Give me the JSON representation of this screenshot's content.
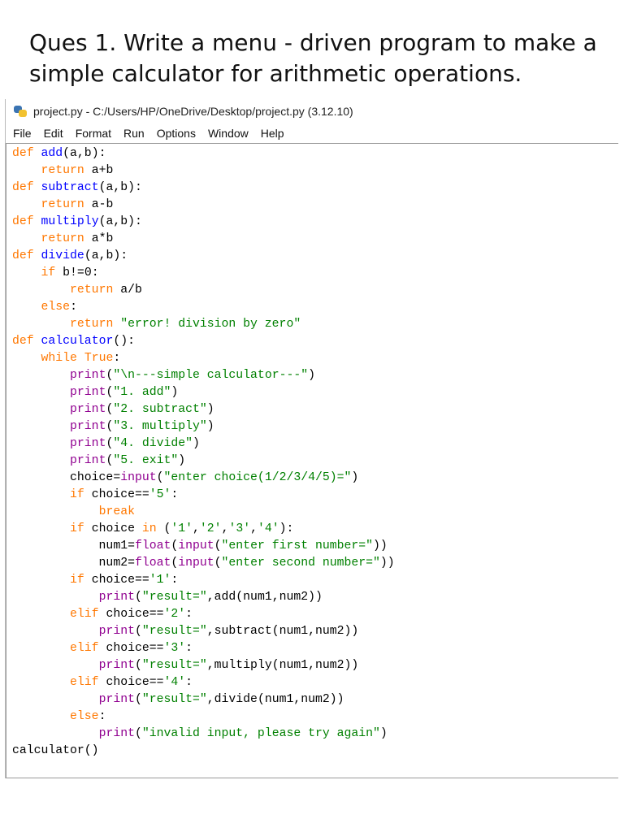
{
  "question": "Ques 1. Write a menu - driven program to make a simple calculator for arithmetic operations.",
  "window": {
    "title": "project.py - C:/Users/HP/OneDrive/Desktop/project.py (3.12.10)",
    "app_icon": "python-icon"
  },
  "menu": [
    "File",
    "Edit",
    "Format",
    "Run",
    "Options",
    "Window",
    "Help"
  ],
  "colors": {
    "keyword": "#ff7700",
    "definition": "#0000ff",
    "builtin": "#900090",
    "string": "#008000",
    "default": "#000000"
  },
  "code_lines": [
    [
      [
        "kw",
        "def "
      ],
      [
        "fn",
        "add"
      ],
      [
        "",
        "(a,b):"
      ]
    ],
    [
      [
        "",
        "    "
      ],
      [
        "kw",
        "return"
      ],
      [
        "",
        " a+b"
      ]
    ],
    [
      [
        "kw",
        "def "
      ],
      [
        "fn",
        "subtract"
      ],
      [
        "",
        "(a,b):"
      ]
    ],
    [
      [
        "",
        "    "
      ],
      [
        "kw",
        "return"
      ],
      [
        "",
        " a-b"
      ]
    ],
    [
      [
        "kw",
        "def "
      ],
      [
        "fn",
        "multiply"
      ],
      [
        "",
        "(a,b):"
      ]
    ],
    [
      [
        "",
        "    "
      ],
      [
        "kw",
        "return"
      ],
      [
        "",
        " a*b"
      ]
    ],
    [
      [
        "kw",
        "def "
      ],
      [
        "fn",
        "divide"
      ],
      [
        "",
        "(a,b):"
      ]
    ],
    [
      [
        "",
        "    "
      ],
      [
        "kw",
        "if"
      ],
      [
        "",
        " b!=0:"
      ]
    ],
    [
      [
        "",
        "        "
      ],
      [
        "kw",
        "return"
      ],
      [
        "",
        " a/b"
      ]
    ],
    [
      [
        "",
        "    "
      ],
      [
        "kw",
        "else"
      ],
      [
        "",
        ":"
      ]
    ],
    [
      [
        "",
        "        "
      ],
      [
        "kw",
        "return"
      ],
      [
        "st",
        " \"error! division by zero\""
      ]
    ],
    [
      [
        "kw",
        "def "
      ],
      [
        "fn",
        "calculator"
      ],
      [
        "",
        "():"
      ]
    ],
    [
      [
        "",
        "    "
      ],
      [
        "kw",
        "while"
      ],
      [
        "kw",
        " True"
      ],
      [
        "",
        ":"
      ]
    ],
    [
      [
        "",
        "        "
      ],
      [
        "bi",
        "print"
      ],
      [
        "",
        "("
      ],
      [
        "st",
        "\"\\n---simple calculator---\""
      ],
      [
        "",
        ")"
      ]
    ],
    [
      [
        "",
        "        "
      ],
      [
        "bi",
        "print"
      ],
      [
        "",
        "("
      ],
      [
        "st",
        "\"1. add\""
      ],
      [
        "",
        ")"
      ]
    ],
    [
      [
        "",
        "        "
      ],
      [
        "bi",
        "print"
      ],
      [
        "",
        "("
      ],
      [
        "st",
        "\"2. subtract\""
      ],
      [
        "",
        ")"
      ]
    ],
    [
      [
        "",
        "        "
      ],
      [
        "bi",
        "print"
      ],
      [
        "",
        "("
      ],
      [
        "st",
        "\"3. multiply\""
      ],
      [
        "",
        ")"
      ]
    ],
    [
      [
        "",
        "        "
      ],
      [
        "bi",
        "print"
      ],
      [
        "",
        "("
      ],
      [
        "st",
        "\"4. divide\""
      ],
      [
        "",
        ")"
      ]
    ],
    [
      [
        "",
        "        "
      ],
      [
        "bi",
        "print"
      ],
      [
        "",
        "("
      ],
      [
        "st",
        "\"5. exit\""
      ],
      [
        "",
        ")"
      ]
    ],
    [
      [
        "",
        "        choice="
      ],
      [
        "bi",
        "input"
      ],
      [
        "",
        "("
      ],
      [
        "st",
        "\"enter choice(1/2/3/4/5)=\""
      ],
      [
        "",
        ")"
      ]
    ],
    [
      [
        "",
        "        "
      ],
      [
        "kw",
        "if"
      ],
      [
        "",
        " choice=="
      ],
      [
        "st",
        "'5'"
      ],
      [
        "",
        ":"
      ]
    ],
    [
      [
        "",
        "            "
      ],
      [
        "kw",
        "break"
      ]
    ],
    [
      [
        "",
        "        "
      ],
      [
        "kw",
        "if"
      ],
      [
        "",
        " choice "
      ],
      [
        "kw",
        "in"
      ],
      [
        "",
        " ("
      ],
      [
        "st",
        "'1'"
      ],
      [
        "",
        ","
      ],
      [
        "st",
        "'2'"
      ],
      [
        "",
        ","
      ],
      [
        "st",
        "'3'"
      ],
      [
        "",
        ","
      ],
      [
        "st",
        "'4'"
      ],
      [
        "",
        "):"
      ]
    ],
    [
      [
        "",
        "            num1="
      ],
      [
        "bi",
        "float"
      ],
      [
        "",
        "("
      ],
      [
        "bi",
        "input"
      ],
      [
        "",
        "("
      ],
      [
        "st",
        "\"enter first number=\""
      ],
      [
        "",
        "))"
      ]
    ],
    [
      [
        "",
        "            num2="
      ],
      [
        "bi",
        "float"
      ],
      [
        "",
        "("
      ],
      [
        "bi",
        "input"
      ],
      [
        "",
        "("
      ],
      [
        "st",
        "\"enter second number=\""
      ],
      [
        "",
        "))"
      ]
    ],
    [
      [
        "",
        "        "
      ],
      [
        "kw",
        "if"
      ],
      [
        "",
        " choice=="
      ],
      [
        "st",
        "'1'"
      ],
      [
        "",
        ":"
      ]
    ],
    [
      [
        "",
        "            "
      ],
      [
        "bi",
        "print"
      ],
      [
        "",
        "("
      ],
      [
        "st",
        "\"result=\""
      ],
      [
        "",
        ",add(num1,num2))"
      ]
    ],
    [
      [
        "",
        "        "
      ],
      [
        "kw",
        "elif"
      ],
      [
        "",
        " choice=="
      ],
      [
        "st",
        "'2'"
      ],
      [
        "",
        ":"
      ]
    ],
    [
      [
        "",
        "            "
      ],
      [
        "bi",
        "print"
      ],
      [
        "",
        "("
      ],
      [
        "st",
        "\"result=\""
      ],
      [
        "",
        ",subtract(num1,num2))"
      ]
    ],
    [
      [
        "",
        "        "
      ],
      [
        "kw",
        "elif"
      ],
      [
        "",
        " choice=="
      ],
      [
        "st",
        "'3'"
      ],
      [
        "",
        ":"
      ]
    ],
    [
      [
        "",
        "            "
      ],
      [
        "bi",
        "print"
      ],
      [
        "",
        "("
      ],
      [
        "st",
        "\"result=\""
      ],
      [
        "",
        ",multiply(num1,num2))"
      ]
    ],
    [
      [
        "",
        "        "
      ],
      [
        "kw",
        "elif"
      ],
      [
        "",
        " choice=="
      ],
      [
        "st",
        "'4'"
      ],
      [
        "",
        ":"
      ]
    ],
    [
      [
        "",
        "            "
      ],
      [
        "bi",
        "print"
      ],
      [
        "",
        "("
      ],
      [
        "st",
        "\"result=\""
      ],
      [
        "",
        ",divide(num1,num2))"
      ]
    ],
    [
      [
        "",
        "        "
      ],
      [
        "kw",
        "else"
      ],
      [
        "",
        ":"
      ]
    ],
    [
      [
        "",
        "            "
      ],
      [
        "bi",
        "print"
      ],
      [
        "",
        "("
      ],
      [
        "st",
        "\"invalid input, please try again\""
      ],
      [
        "",
        ")"
      ]
    ],
    [
      [
        "",
        "calculator()"
      ]
    ]
  ]
}
